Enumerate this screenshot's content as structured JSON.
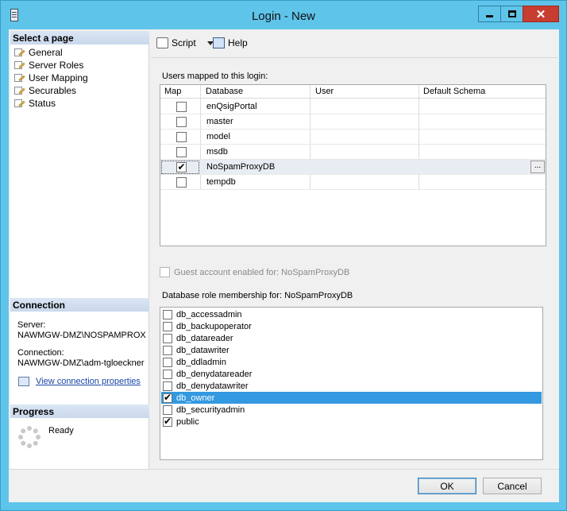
{
  "window": {
    "title": "Login - New"
  },
  "left": {
    "select_page_header": "Select a page",
    "pages": [
      {
        "label": "General"
      },
      {
        "label": "Server Roles"
      },
      {
        "label": "User Mapping"
      },
      {
        "label": "Securables"
      },
      {
        "label": "Status"
      }
    ],
    "connection_header": "Connection",
    "server_label": "Server:",
    "server_value": "NAWMGW-DMZ\\NOSPAMPROX",
    "connection_label": "Connection:",
    "connection_value": "NAWMGW-DMZ\\adm-tgloeckner",
    "view_props_link": "View connection properties",
    "progress_header": "Progress",
    "progress_status": "Ready"
  },
  "toolbar": {
    "script_label": "Script",
    "help_label": "Help"
  },
  "mapping": {
    "label": "Users mapped to this login:",
    "columns": [
      "Map",
      "Database",
      "User",
      "Default Schema"
    ],
    "rows": [
      {
        "checked": false,
        "database": "enQsigPortal",
        "user": "",
        "schema": ""
      },
      {
        "checked": false,
        "database": "master",
        "user": "",
        "schema": ""
      },
      {
        "checked": false,
        "database": "model",
        "user": "",
        "schema": ""
      },
      {
        "checked": false,
        "database": "msdb",
        "user": "",
        "schema": ""
      },
      {
        "checked": true,
        "database": "NoSpamProxyDB",
        "user": "",
        "schema": "",
        "ellipsis": "..."
      },
      {
        "checked": false,
        "database": "tempdb",
        "user": "",
        "schema": ""
      }
    ]
  },
  "guest": {
    "label": "Guest account enabled for: NoSpamProxyDB",
    "checked": false
  },
  "roles": {
    "label": "Database role membership for: NoSpamProxyDB",
    "items": [
      {
        "name": "db_accessadmin",
        "checked": false
      },
      {
        "name": "db_backupoperator",
        "checked": false
      },
      {
        "name": "db_datareader",
        "checked": false
      },
      {
        "name": "db_datawriter",
        "checked": false
      },
      {
        "name": "db_ddladmin",
        "checked": false
      },
      {
        "name": "db_denydatareader",
        "checked": false
      },
      {
        "name": "db_denydatawriter",
        "checked": false
      },
      {
        "name": "db_owner",
        "checked": true
      },
      {
        "name": "db_securityadmin",
        "checked": false
      },
      {
        "name": "public",
        "checked": true
      }
    ]
  },
  "buttons": {
    "ok": "OK",
    "cancel": "Cancel"
  },
  "check_glyph": "✔",
  "close_glyph": "✕"
}
